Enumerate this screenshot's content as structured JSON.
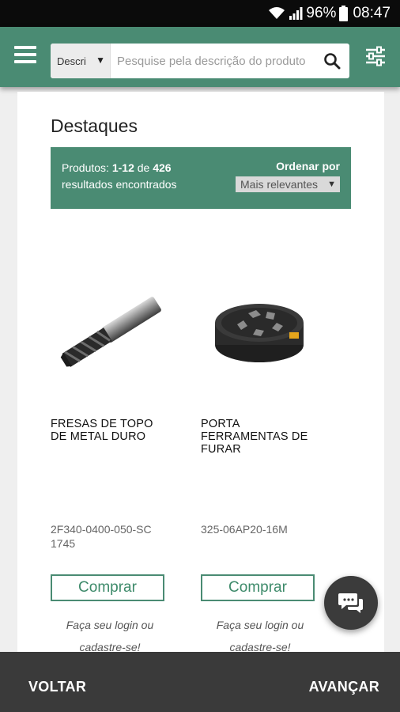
{
  "status_bar": {
    "battery": "96%",
    "time": "08:47"
  },
  "app_bar": {
    "search_select": "Descri",
    "search_placeholder": "Pesquise pela descrição do produto"
  },
  "page": {
    "title": "Destaques",
    "results_prefix": "Produtos: ",
    "results_range": "1-12",
    "results_of": " de ",
    "results_total": "426",
    "results_suffix": "resultados encontrados",
    "sort_label": "Ordenar por",
    "sort_selected": "Mais relevantes"
  },
  "products": [
    {
      "name": "FRESAS DE TOPO DE METAL DURO",
      "code": "2F340-0400-050-SC 1745",
      "buy_label": "Comprar",
      "login_text": "Faça seu login ou cadastre-se!"
    },
    {
      "name": "PORTA FERRAMENTAS DE FURAR",
      "code": "325-06AP20-16M",
      "buy_label": "Comprar",
      "login_text": "Faça seu login ou cadastre-se!"
    }
  ],
  "bottom_bar": {
    "back_label": "VOLTAR",
    "next_label": "AVANÇAR"
  },
  "colors": {
    "brand": "#4a8b73",
    "bottom_bar": "#3a3a3a"
  }
}
